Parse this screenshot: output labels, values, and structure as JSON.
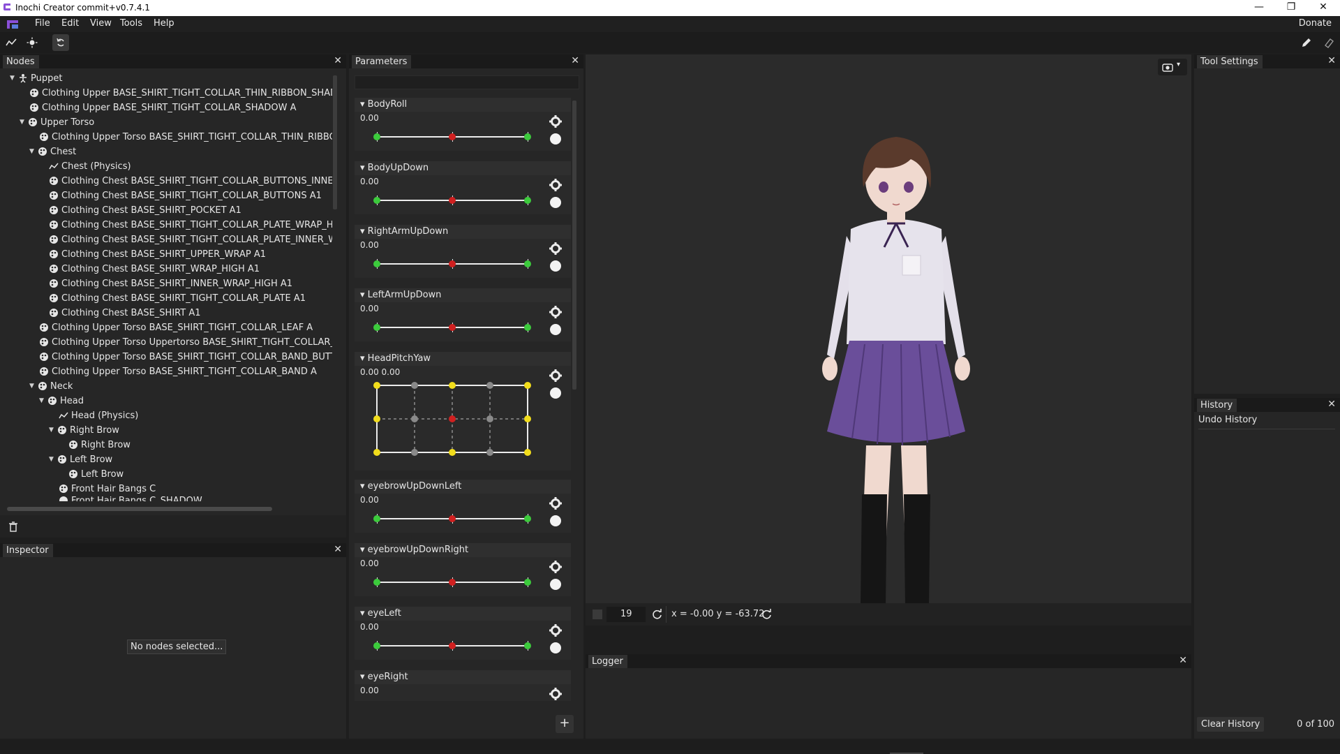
{
  "window": {
    "title": "Inochi Creator commit+v0.7.4.1",
    "controls": [
      "—",
      "❐",
      "✕"
    ]
  },
  "menu": {
    "items": [
      "File",
      "Edit",
      "View",
      "Tools",
      "Help"
    ],
    "donate": "Donate"
  },
  "nodes_panel": {
    "title": "Nodes",
    "rows": [
      {
        "label": "Puppet",
        "expanded": true
      },
      {
        "label": "Clothing Upper BASE_SHIRT_TIGHT_COLLAR_THIN_RIBBON_SHADOW"
      },
      {
        "label": "Clothing Upper BASE_SHIRT_TIGHT_COLLAR_SHADOW A"
      },
      {
        "label": "Upper Torso",
        "expanded": true
      },
      {
        "label": "Clothing Upper Torso BASE_SHIRT_TIGHT_COLLAR_THIN_RIBBON"
      },
      {
        "label": "Chest",
        "expanded": true
      },
      {
        "label": "Chest (Physics)"
      },
      {
        "label": "Clothing Chest BASE_SHIRT_TIGHT_COLLAR_BUTTONS_INNER_W"
      },
      {
        "label": "Clothing Chest BASE_SHIRT_TIGHT_COLLAR_BUTTONS A1"
      },
      {
        "label": "Clothing Chest BASE_SHIRT_POCKET A1"
      },
      {
        "label": "Clothing Chest BASE_SHIRT_TIGHT_COLLAR_PLATE_WRAP_HIGH"
      },
      {
        "label": "Clothing Chest BASE_SHIRT_TIGHT_COLLAR_PLATE_INNER_WRA"
      },
      {
        "label": "Clothing Chest BASE_SHIRT_UPPER_WRAP A1"
      },
      {
        "label": "Clothing Chest BASE_SHIRT_WRAP_HIGH A1"
      },
      {
        "label": "Clothing Chest BASE_SHIRT_INNER_WRAP_HIGH A1"
      },
      {
        "label": "Clothing Chest BASE_SHIRT_TIGHT_COLLAR_PLATE A1"
      },
      {
        "label": "Clothing Chest BASE_SHIRT A1"
      },
      {
        "label": "Clothing Upper Torso BASE_SHIRT_TIGHT_COLLAR_LEAF A"
      },
      {
        "label": "Clothing Upper Torso Uppertorso BASE_SHIRT_TIGHT_COLLAR_RI"
      },
      {
        "label": "Clothing Upper Torso BASE_SHIRT_TIGHT_COLLAR_BAND_BUTTOI"
      },
      {
        "label": "Clothing Upper Torso BASE_SHIRT_TIGHT_COLLAR_BAND A"
      },
      {
        "label": "Neck",
        "expanded": true
      },
      {
        "label": "Head",
        "expanded": true
      },
      {
        "label": "Head (Physics)"
      },
      {
        "label": "Right Brow",
        "expanded": true
      },
      {
        "label": "Right Brow"
      },
      {
        "label": "Left Brow",
        "expanded": true
      },
      {
        "label": "Left Brow"
      },
      {
        "label": "Front Hair Bangs C"
      },
      {
        "label": "Front Hair Bangs C_SHADOW"
      }
    ]
  },
  "inspector": {
    "title": "Inspector",
    "empty_message": "No nodes selected..."
  },
  "parameters": {
    "title": "Parameters",
    "search_placeholder": "",
    "items": [
      {
        "name": "BodyRoll",
        "value": "0.00"
      },
      {
        "name": "BodyUpDown",
        "value": "0.00"
      },
      {
        "name": "RightArmUpDown",
        "value": "0.00"
      },
      {
        "name": "LeftArmUpDown",
        "value": "0.00"
      },
      {
        "name": "HeadPitchYaw",
        "value": "0.00 0.00"
      },
      {
        "name": "eyebrowUpDownLeft",
        "value": "0.00"
      },
      {
        "name": "eyebrowUpDownRight",
        "value": "0.00"
      },
      {
        "name": "eyeLeft",
        "value": "0.00"
      },
      {
        "name": "eyeRight",
        "value": "0.00"
      }
    ],
    "add_label": "+"
  },
  "viewport": {
    "zoom_value": "19",
    "coords": "x = -0.00 y = -63.72"
  },
  "logger": {
    "title": "Logger"
  },
  "tool_settings": {
    "title": "Tool Settings"
  },
  "history": {
    "title": "History",
    "subtitle": "Undo History",
    "clear_label": "Clear History",
    "count": "0 of 100"
  },
  "colors": {
    "accent_purple": "#8a4fd8",
    "knob_green": "#3ccb3c",
    "knob_red": "#d02020",
    "knob_yellow": "#f2dd1c"
  },
  "icons": [
    "app-logo-icon",
    "physics-icon",
    "sun-icon",
    "refresh-icon",
    "pencil-icon",
    "eraser-icon",
    "camera-icon",
    "chevron-down-icon",
    "trash-icon",
    "gear-icon",
    "puppet-icon",
    "node-icon"
  ]
}
